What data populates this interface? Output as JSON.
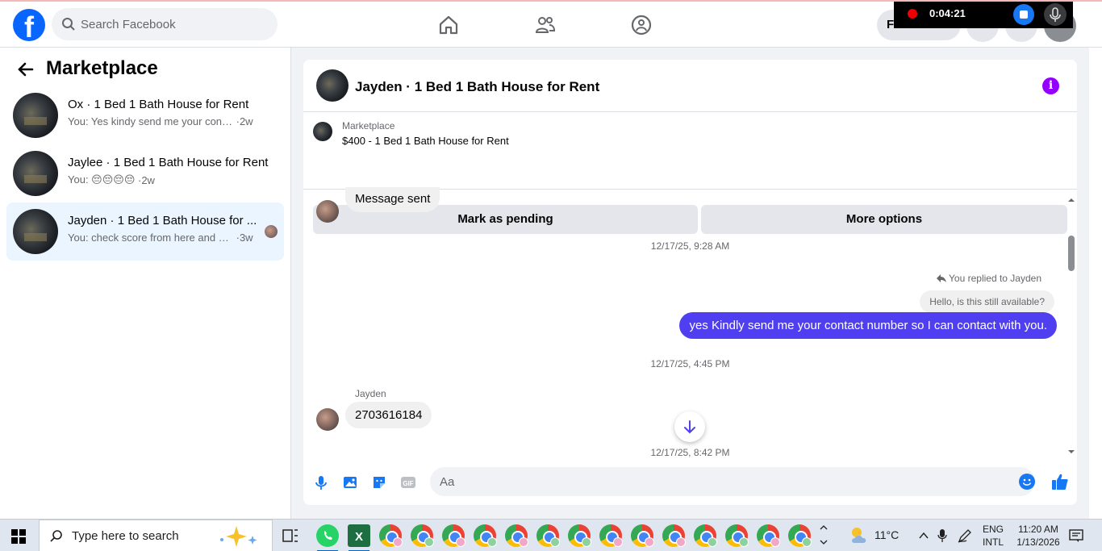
{
  "topbar": {
    "logo": "f",
    "search_placeholder": "Search Facebook",
    "nav_icons": [
      "home-icon",
      "friends-icon",
      "groups-icon"
    ],
    "find_button": "Fi",
    "recording": {
      "time": "0:04:21"
    }
  },
  "sidebar": {
    "title": "Marketplace",
    "conversations": [
      {
        "title": "Ox · 1 Bed 1 Bath House for Rent",
        "preview": "You: Yes kindy send me your contact ...",
        "age": "·2w",
        "active": false
      },
      {
        "title": "Jaylee · 1 Bed 1 Bath House for Rent",
        "preview": "You: 😔😔😔😔",
        "age": "·2w",
        "active": false
      },
      {
        "title": "Jayden · 1 Bed 1 Bath House for ...",
        "preview": "You: check score from here and se...",
        "age": "·3w",
        "active": true
      }
    ]
  },
  "chat": {
    "title": "Jayden · 1 Bed 1 Bath House for Rent",
    "info_icon": "i",
    "listing": {
      "label": "Marketplace",
      "title": "$400 - 1 Bed 1 Bath House for Rent",
      "buttons": [
        "Mark as pending",
        "More options"
      ]
    },
    "messages": {
      "first_incoming": "Message sent",
      "ts1": "12/17/25, 9:28 AM",
      "reply_context": "You replied to Jayden",
      "reply_quote": "Hello, is this still available?",
      "outgoing": "yes Kindly send me your contact number so I can contact with you.",
      "ts2": "12/17/25, 4:45 PM",
      "sender": "Jayden",
      "incoming_number": "2703616184",
      "ts3": "12/17/25, 8:42 PM"
    },
    "composer": {
      "placeholder": "Aa"
    }
  },
  "taskbar": {
    "search_label": "Type here to search",
    "weather": "11°C",
    "lang_line1": "ENG",
    "lang_line2": "INTL",
    "time": "11:20 AM",
    "date": "1/13/2026"
  }
}
